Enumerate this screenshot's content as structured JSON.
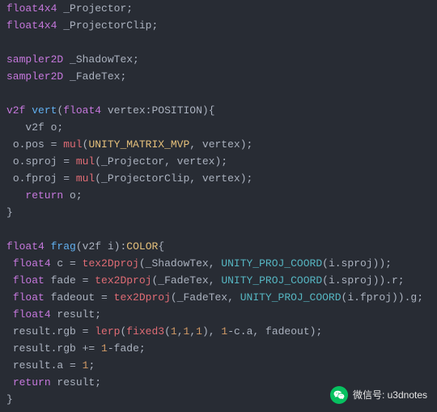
{
  "code": {
    "l01": {
      "type": "float4x4",
      "name": "_Projector",
      "semi": ";"
    },
    "l02": {
      "type": "float4x4",
      "name": "_ProjectorClip",
      "semi": ";"
    },
    "l03": {},
    "l04": {
      "type": "sampler2D",
      "name": "_ShadowTex",
      "semi": ";"
    },
    "l05": {
      "type": "sampler2D",
      "name": "_FadeTex",
      "semi": ";"
    },
    "l06": {},
    "l07": {
      "rtype": "v2f",
      "fname": "vert",
      "lp": "(",
      "ptype": "float4",
      "pname": " vertex",
      "colon": ":",
      "sem": "POSITION",
      "rp": ")",
      "lb": "{"
    },
    "l08": {
      "indent": "   ",
      "type": "v2f",
      "name": " o",
      "semi": ";"
    },
    "l09": {
      "indent": " ",
      "lhs": "o.pos",
      "eq": " = ",
      "fn": "mul",
      "lp": "(",
      "a": "UNITY_MATRIX_MVP",
      "c": ", ",
      "b": "vertex",
      "rp": ")",
      "semi": ";"
    },
    "l10": {
      "indent": " ",
      "lhs": "o.sproj",
      "eq": " = ",
      "fn": "mul",
      "lp": "(",
      "a": "_Projector",
      "c": ", ",
      "b": "vertex",
      "rp": ")",
      "semi": ";"
    },
    "l11": {
      "indent": " ",
      "lhs": "o.fproj",
      "eq": " = ",
      "fn": "mul",
      "lp": "(",
      "a": "_ProjectorClip",
      "c": ", ",
      "b": "vertex",
      "rp": ")",
      "semi": ";"
    },
    "l12": {
      "indent": "   ",
      "kw": "return",
      "val": " o",
      "semi": ";"
    },
    "l13": {
      "rb": "}"
    },
    "l14": {},
    "l15": {
      "rtype": "float4",
      "fname": "frag",
      "lp": "(",
      "ptype": "v2f",
      "pname": " i",
      "rp": ")",
      "colon": ":",
      "sem": "COLOR",
      "lb": "{"
    },
    "l16": {
      "indent": " ",
      "type": "float4",
      "name": " c",
      "eq": " = ",
      "fn": "tex2Dproj",
      "lp": "(",
      "a": "_ShadowTex",
      "c": ", ",
      "fn2": "UNITY_PROJ_COORD",
      "lp2": "(",
      "b": "i.sproj",
      "rp2": ")",
      "rp": ")",
      "semi": ";"
    },
    "l17": {
      "indent": " ",
      "type": "float",
      "name": " fade",
      "eq": " = ",
      "fn": "tex2Dproj",
      "lp": "(",
      "a": "_FadeTex",
      "c": ", ",
      "fn2": "UNITY_PROJ_COORD",
      "lp2": "(",
      "b": "i.sproj",
      "rp2": ")",
      "rp": ")",
      "dot": ".r",
      "semi": ";"
    },
    "l18": {
      "indent": " ",
      "type": "float",
      "name": " fadeout",
      "eq": " = ",
      "fn": "tex2Dproj",
      "lp": "(",
      "a": "_FadeTex",
      "c": ", ",
      "fn2": "UNITY_PROJ_COORD",
      "lp2": "(",
      "b": "i.fproj",
      "rp2": ")",
      "rp": ")",
      "dot": ".g",
      "semi": ";"
    },
    "l19": {
      "indent": " ",
      "type": "float4",
      "name": " result",
      "semi": ";"
    },
    "l20": {
      "indent": " ",
      "lhs": "result.rgb",
      "eq": " = ",
      "fn": "lerp",
      "lp": "(",
      "fn2": "fixed3",
      "lp2": "(",
      "n1": "1",
      "c1": ",",
      "n2": "1",
      "c2": ",",
      "n3": "1",
      "rp2": ")",
      "c": ", ",
      "one": "1",
      "minus": "-c.a",
      "c3": ", ",
      "arg3": "fadeout",
      "rp": ")",
      "semi": ";"
    },
    "l21": {
      "indent": " ",
      "lhs": "result.rgb",
      "op": " += ",
      "one": "1",
      "minus": "-fade",
      "semi": ";"
    },
    "l22": {
      "indent": " ",
      "lhs": "result.a",
      "eq": " = ",
      "val": "1",
      "semi": ";"
    },
    "l23": {
      "indent": " ",
      "kw": "return",
      "val": " result",
      "semi": ";"
    },
    "l24": {
      "rb": "}"
    }
  },
  "footer": {
    "label": "微信号: u3dnotes"
  }
}
